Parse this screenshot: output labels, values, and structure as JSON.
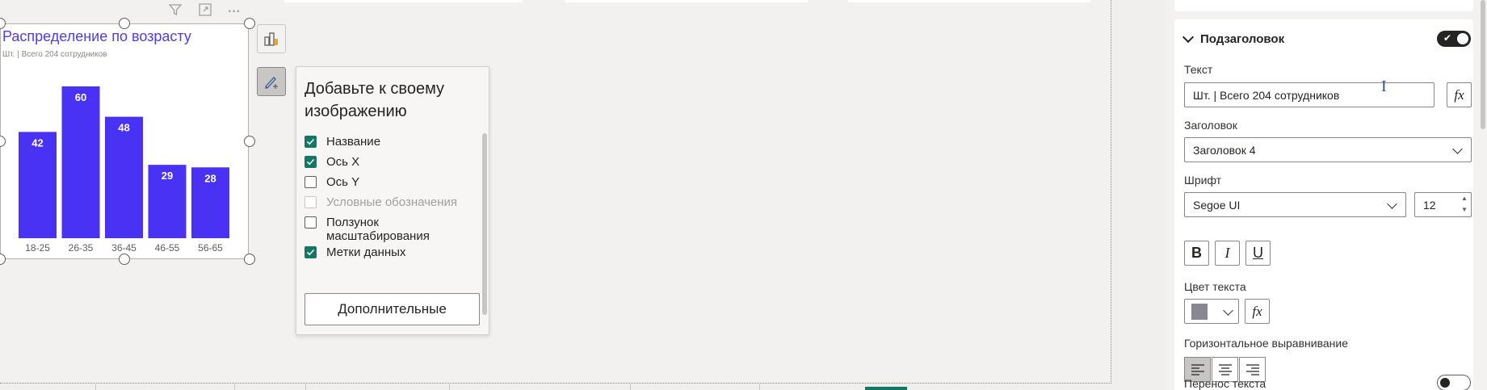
{
  "chart_data": {
    "type": "bar",
    "title": "Распределение по возрасту",
    "subtitle": "Шт. | Всего 204 сотрудников",
    "categories": [
      "18-25",
      "26-35",
      "36-45",
      "46-55",
      "56-65"
    ],
    "values": [
      42,
      60,
      48,
      29,
      28
    ],
    "ylim": [
      0,
      60
    ],
    "data_labels": true,
    "color": "#4a32f5"
  },
  "visual_header": {
    "filter_icon": "filter-icon",
    "focus_icon": "focus-mode-icon",
    "more_icon": "more-options-icon",
    "more_glyph": "···"
  },
  "popup": {
    "title": "Добавьте к своему изображению",
    "options": [
      {
        "label": "Название",
        "checked": true,
        "disabled": false
      },
      {
        "label": "Ось X",
        "checked": true,
        "disabled": false
      },
      {
        "label": "Ось Y",
        "checked": false,
        "disabled": false
      },
      {
        "label": "Условные обозначения",
        "checked": false,
        "disabled": true
      },
      {
        "label": "Ползунок масштабирования",
        "checked": false,
        "disabled": false
      },
      {
        "label": "Метки данных",
        "checked": true,
        "disabled": false
      }
    ],
    "more_button": "Дополнительные"
  },
  "format_pane": {
    "section_title": "Подзаголовок",
    "section_enabled": true,
    "text_label": "Текст",
    "text_value": "Шт. | Всего 204 сотрудников",
    "fx_label": "fx",
    "heading_label": "Заголовок",
    "heading_value": "Заголовок 4",
    "font_label": "Шрифт",
    "font_value": "Segoe UI",
    "font_size": "12",
    "bold_label": "B",
    "italic_label": "I",
    "underline_label": "U",
    "text_color_label": "Цвет текста",
    "text_color": "#8a8693",
    "halign_label": "Горизонтальное выравнивание",
    "halign_selected": "left",
    "wrap_label": "Перенос текста",
    "wrap_enabled": false
  }
}
